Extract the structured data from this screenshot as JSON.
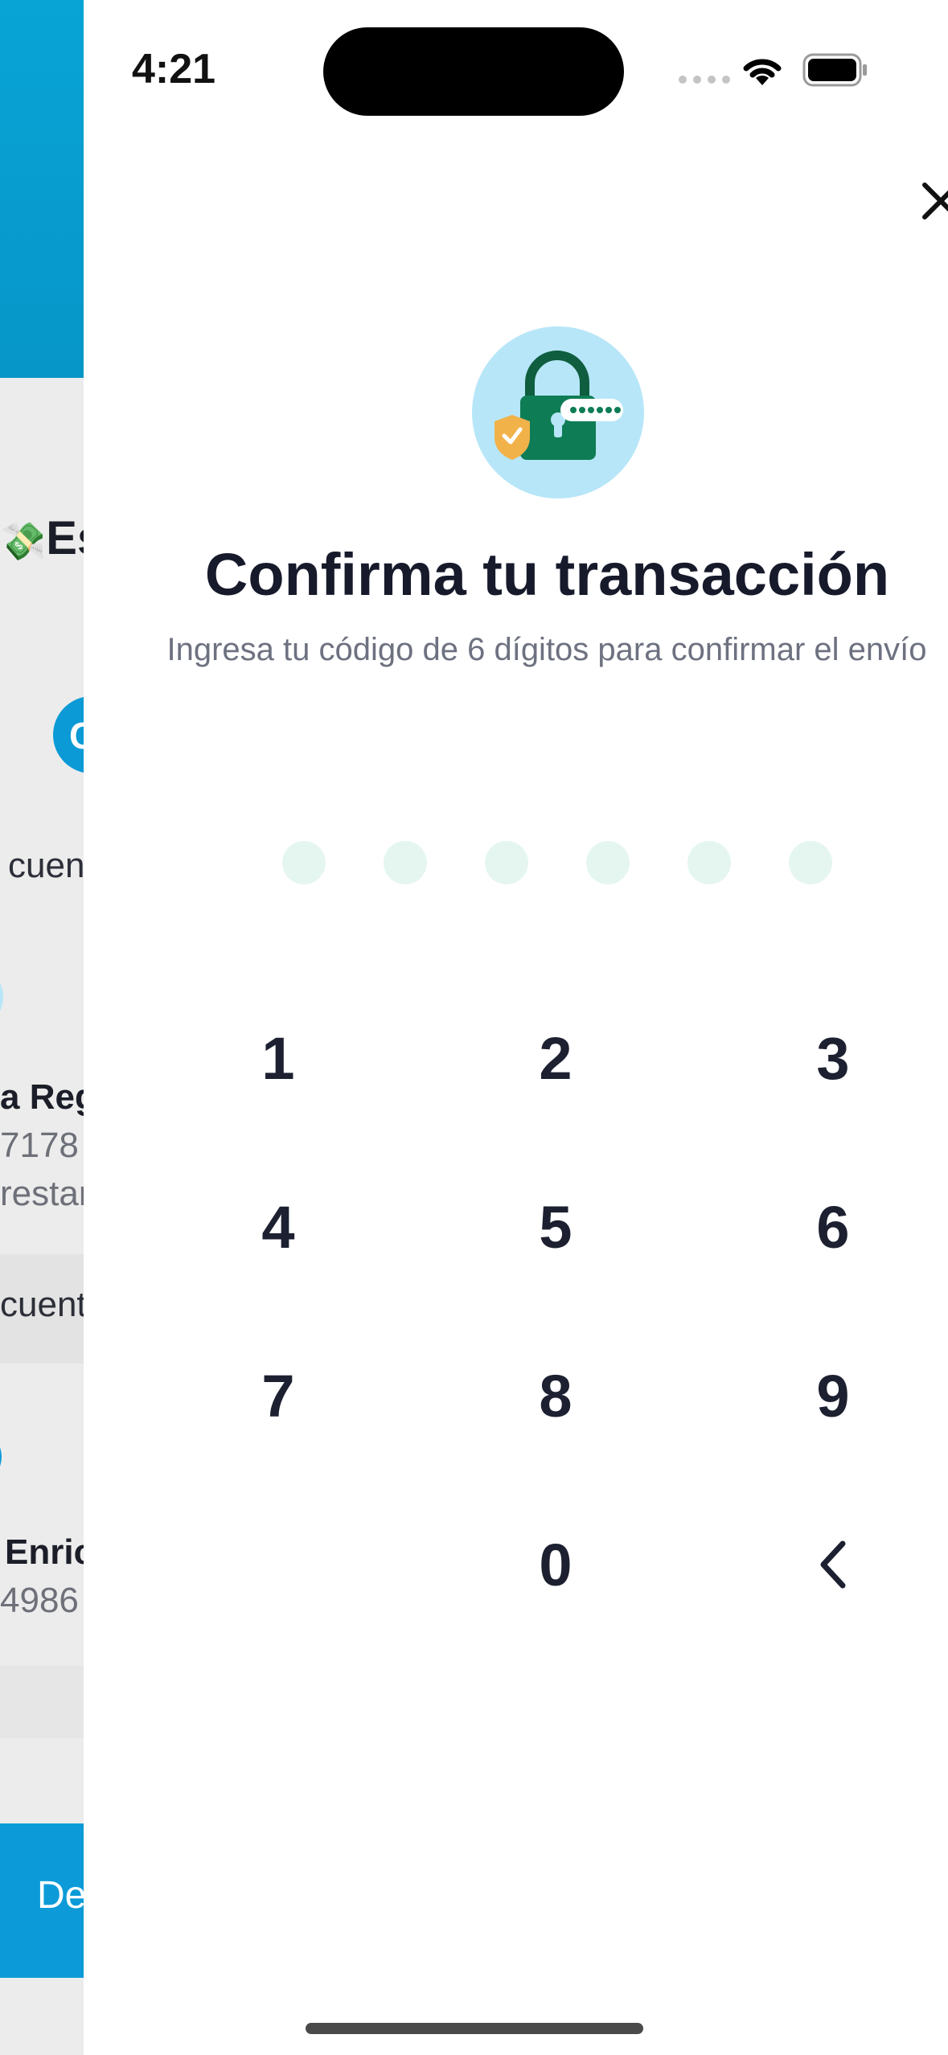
{
  "status_bar": {
    "time": "4:21"
  },
  "background_app": {
    "heading_fragment": "Es",
    "tab_fragment": "C",
    "section1_fragment": "cuen",
    "contact1": {
      "name_fragment": "a Reg",
      "number_fragment": "7178",
      "extra_fragment": "restar"
    },
    "section2_fragment": "cuent",
    "contact2": {
      "name_fragment": "Enric",
      "number_fragment": "4986"
    },
    "button_fragment": "De",
    "colors": {
      "header": "#08a4d6",
      "button": "#0c9bd8"
    }
  },
  "modal": {
    "illustration": "lock-shield-password-icon",
    "title": "Confirma tu transacción",
    "subtitle": "Ingresa tu código de 6 dígitos para confirmar el envío",
    "pin_length": 6,
    "close_icon": "close-icon",
    "keypad": {
      "k1": "1",
      "k2": "2",
      "k3": "3",
      "k4": "4",
      "k5": "5",
      "k6": "6",
      "k7": "7",
      "k8": "8",
      "k9": "9",
      "k0": "0",
      "backspace_icon": "chevron-left-icon"
    },
    "colors": {
      "pin_dot": "#e5f6f1",
      "illustration_bg": "#b7e6f8",
      "lock": "#0e7d55",
      "shield": "#f2b24a"
    }
  }
}
